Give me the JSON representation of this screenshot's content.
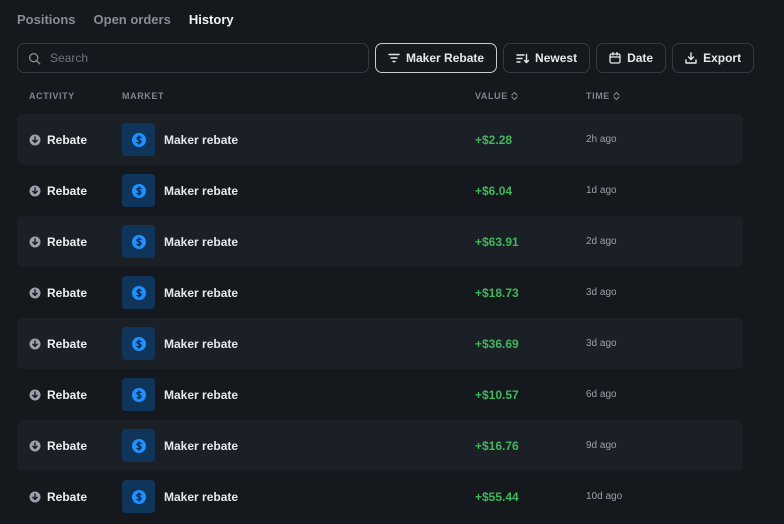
{
  "tabs": [
    {
      "label": "Positions",
      "active": false
    },
    {
      "label": "Open orders",
      "active": false
    },
    {
      "label": "History",
      "active": true
    }
  ],
  "toolbar": {
    "search_placeholder": "Search",
    "search_value": "",
    "filter_label": "Maker Rebate",
    "sort_label": "Newest",
    "date_label": "Date",
    "export_label": "Export"
  },
  "columns": {
    "activity": "ACTIVITY",
    "market": "MARKET",
    "value": "VALUE",
    "time": "TIME"
  },
  "icons": {
    "search": "search-icon",
    "filter": "filter-icon",
    "sort": "sort-icon",
    "date": "calendar-icon",
    "export": "download-icon",
    "activity": "arrow-down-circle-icon",
    "market": "dollar-coin-icon",
    "sortable": "sort-arrows-icon"
  },
  "colors": {
    "background": "#15191e",
    "row_alt": "#1b2026",
    "positive": "#3fb75a",
    "coin": "#1e90ff",
    "thumb": "#10355a"
  },
  "rows": [
    {
      "activity": "Rebate",
      "market": "Maker rebate",
      "value": "+$2.28",
      "time": "2h ago"
    },
    {
      "activity": "Rebate",
      "market": "Maker rebate",
      "value": "+$6.04",
      "time": "1d ago"
    },
    {
      "activity": "Rebate",
      "market": "Maker rebate",
      "value": "+$63.91",
      "time": "2d ago"
    },
    {
      "activity": "Rebate",
      "market": "Maker rebate",
      "value": "+$18.73",
      "time": "3d ago"
    },
    {
      "activity": "Rebate",
      "market": "Maker rebate",
      "value": "+$36.69",
      "time": "3d ago"
    },
    {
      "activity": "Rebate",
      "market": "Maker rebate",
      "value": "+$10.57",
      "time": "6d ago"
    },
    {
      "activity": "Rebate",
      "market": "Maker rebate",
      "value": "+$16.76",
      "time": "9d ago"
    },
    {
      "activity": "Rebate",
      "market": "Maker rebate",
      "value": "+$55.44",
      "time": "10d ago"
    }
  ]
}
